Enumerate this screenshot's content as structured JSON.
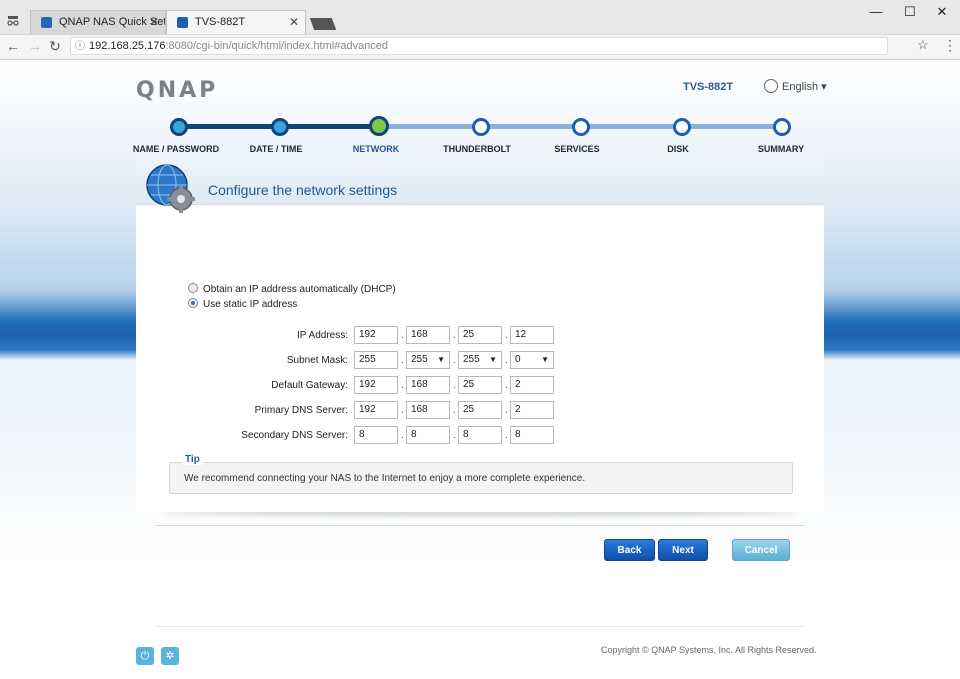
{
  "browser": {
    "tabs": [
      {
        "label": "QNAP NAS Quick Setup",
        "active": false
      },
      {
        "label": "TVS-882T",
        "active": true
      }
    ],
    "url_host": "192.168.25.176",
    "url_path": ":8080/cgi-bin/quick/html/index.html#advanced",
    "window_buttons": {
      "minimize": "—",
      "maximize": "☐",
      "close": "✕"
    }
  },
  "header": {
    "logo": "QNAP",
    "model": "TVS-882T",
    "language": "English ▾"
  },
  "steps": [
    {
      "label": "NAME / PASSWORD",
      "state": "done"
    },
    {
      "label": "DATE / TIME",
      "state": "done"
    },
    {
      "label": "NETWORK",
      "state": "current"
    },
    {
      "label": "THUNDERBOLT",
      "state": "todo"
    },
    {
      "label": "SERVICES",
      "state": "todo"
    },
    {
      "label": "DISK",
      "state": "todo"
    },
    {
      "label": "SUMMARY",
      "state": "todo"
    }
  ],
  "panel": {
    "title": "Configure the network settings",
    "options": {
      "dhcp": "Obtain an IP address automatically (DHCP)",
      "static": "Use static IP address",
      "selected": "static"
    },
    "fields": {
      "ip": {
        "label": "IP Address:",
        "octets": [
          "192",
          "168",
          "25",
          "12"
        ]
      },
      "mask": {
        "label": "Subnet Mask:",
        "octets": [
          "255",
          "255",
          "255",
          "0"
        ]
      },
      "gateway": {
        "label": "Default Gateway:",
        "octets": [
          "192",
          "168",
          "25",
          "2"
        ]
      },
      "dns1": {
        "label": "Primary DNS Server:",
        "octets": [
          "192",
          "168",
          "25",
          "2"
        ]
      },
      "dns2": {
        "label": "Secondary DNS Server:",
        "octets": [
          "8",
          "8",
          "8",
          "8"
        ]
      }
    },
    "tip": {
      "title": "Tip",
      "text": "We recommend connecting your NAS to the Internet to enjoy a more complete experience."
    },
    "buttons": {
      "back": "Back",
      "next": "Next",
      "cancel": "Cancel"
    }
  },
  "footer": {
    "copyright": "Copyright © QNAP Systems, Inc. All Rights Reserved."
  },
  "colors": {
    "accent": "#1b5a98",
    "primary_button": "#0f4fa8",
    "cancel_button": "#5aaed6",
    "current_step": "#7fc94a"
  }
}
